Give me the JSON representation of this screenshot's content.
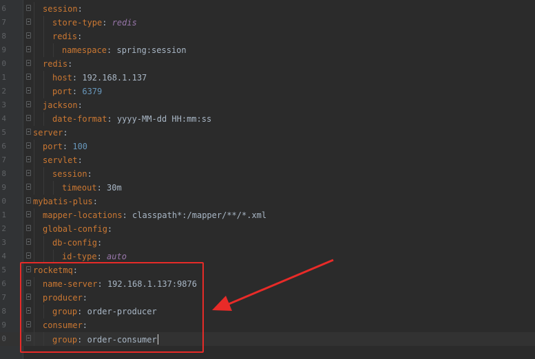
{
  "editor": {
    "lines": [
      {
        "num": "6",
        "indent": 1,
        "key": "session",
        "sep": ":",
        "value": "",
        "vtype": "v"
      },
      {
        "num": "7",
        "indent": 2,
        "key": "store-type",
        "sep": ": ",
        "value": "redis",
        "vtype": "i"
      },
      {
        "num": "8",
        "indent": 2,
        "key": "redis",
        "sep": ":",
        "value": "",
        "vtype": "v"
      },
      {
        "num": "9",
        "indent": 3,
        "key": "namespace",
        "sep": ": ",
        "value": "spring:session",
        "vtype": "v"
      },
      {
        "num": "0",
        "indent": 1,
        "key": "redis",
        "sep": ":",
        "value": "",
        "vtype": "v"
      },
      {
        "num": "1",
        "indent": 2,
        "key": "host",
        "sep": ": ",
        "value": "192.168.1.137",
        "vtype": "v"
      },
      {
        "num": "2",
        "indent": 2,
        "key": "port",
        "sep": ": ",
        "value": "6379",
        "vtype": "n"
      },
      {
        "num": "3",
        "indent": 1,
        "key": "jackson",
        "sep": ":",
        "value": "",
        "vtype": "v"
      },
      {
        "num": "4",
        "indent": 2,
        "key": "date-format",
        "sep": ": ",
        "value": "yyyy-MM-dd HH:mm:ss",
        "vtype": "v"
      },
      {
        "num": "5",
        "indent": 0,
        "key": "server",
        "sep": ":",
        "value": "",
        "vtype": "v"
      },
      {
        "num": "6",
        "indent": 1,
        "key": "port",
        "sep": ": ",
        "value": "100",
        "vtype": "n"
      },
      {
        "num": "7",
        "indent": 1,
        "key": "servlet",
        "sep": ":",
        "value": "",
        "vtype": "v"
      },
      {
        "num": "8",
        "indent": 2,
        "key": "session",
        "sep": ":",
        "value": "",
        "vtype": "v"
      },
      {
        "num": "9",
        "indent": 3,
        "key": "timeout",
        "sep": ": ",
        "value": "30m",
        "vtype": "v"
      },
      {
        "num": "0",
        "indent": 0,
        "key": "mybatis-plus",
        "sep": ":",
        "value": "",
        "vtype": "v"
      },
      {
        "num": "1",
        "indent": 1,
        "key": "mapper-locations",
        "sep": ": ",
        "value": "classpath*:/mapper/**/*.xml",
        "vtype": "v"
      },
      {
        "num": "2",
        "indent": 1,
        "key": "global-config",
        "sep": ":",
        "value": "",
        "vtype": "v"
      },
      {
        "num": "3",
        "indent": 2,
        "key": "db-config",
        "sep": ":",
        "value": "",
        "vtype": "v"
      },
      {
        "num": "4",
        "indent": 3,
        "key": "id-type",
        "sep": ": ",
        "value": "auto",
        "vtype": "i"
      },
      {
        "num": "5",
        "indent": 0,
        "key": "rocketmq",
        "sep": ":",
        "value": "",
        "vtype": "v"
      },
      {
        "num": "6",
        "indent": 1,
        "key": "name-server",
        "sep": ": ",
        "value": "192.168.1.137:9876",
        "vtype": "v"
      },
      {
        "num": "7",
        "indent": 1,
        "key": "producer",
        "sep": ":",
        "value": "",
        "vtype": "v"
      },
      {
        "num": "8",
        "indent": 2,
        "key": "group",
        "sep": ": ",
        "value": "order-producer",
        "vtype": "v"
      },
      {
        "num": "9",
        "indent": 1,
        "key": "consumer",
        "sep": ":",
        "value": "",
        "vtype": "v"
      },
      {
        "num": "0",
        "indent": 2,
        "key": "group",
        "sep": ": ",
        "value": "order-consumer",
        "vtype": "v",
        "current": true
      }
    ]
  },
  "colors": {
    "background": "#2b2b2b",
    "key": "#cc7832",
    "text": "#a9b7c6",
    "number": "#6897bb",
    "keyword": "#9876aa",
    "annotation": "#e82b28"
  }
}
